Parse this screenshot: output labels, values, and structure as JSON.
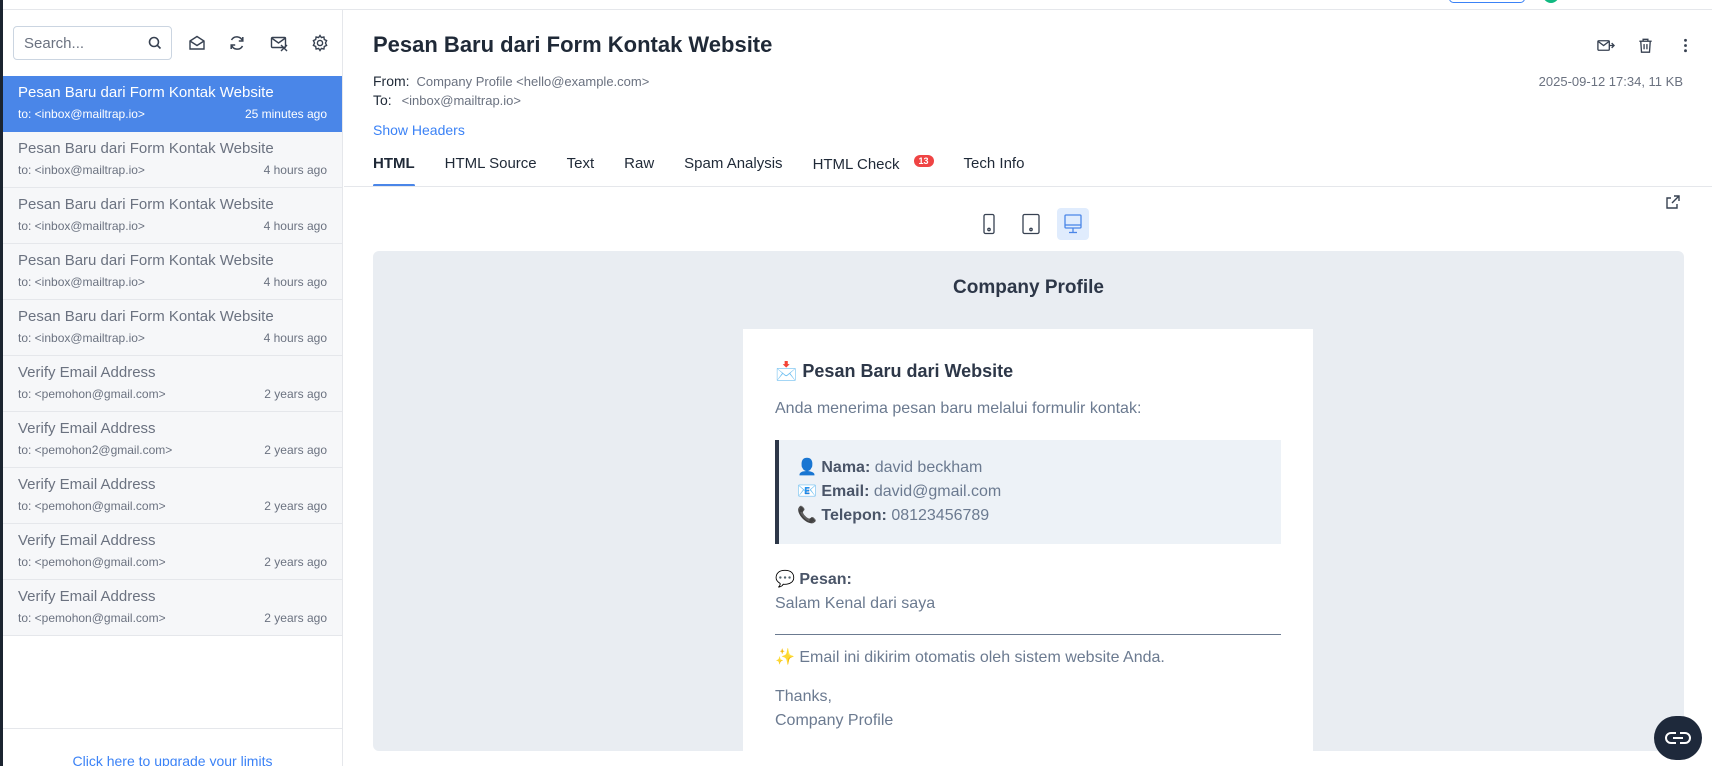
{
  "search": {
    "placeholder": "Search..."
  },
  "sidebar": {
    "toolbar": {
      "icons": [
        "search-icon",
        "mark-read-icon",
        "refresh-icon",
        "clear-inbox-icon",
        "settings-icon"
      ]
    },
    "messages": [
      {
        "subject": "Pesan Baru dari Form Kontak Website",
        "to": "to: <inbox@mailtrap.io>",
        "time": "25 minutes ago",
        "active": true
      },
      {
        "subject": "Pesan Baru dari Form Kontak Website",
        "to": "to: <inbox@mailtrap.io>",
        "time": "4 hours ago"
      },
      {
        "subject": "Pesan Baru dari Form Kontak Website",
        "to": "to: <inbox@mailtrap.io>",
        "time": "4 hours ago"
      },
      {
        "subject": "Pesan Baru dari Form Kontak Website",
        "to": "to: <inbox@mailtrap.io>",
        "time": "4 hours ago"
      },
      {
        "subject": "Pesan Baru dari Form Kontak Website",
        "to": "to: <inbox@mailtrap.io>",
        "time": "4 hours ago"
      },
      {
        "subject": "Verify Email Address",
        "to": "to: <pemohon@gmail.com>",
        "time": "2 years ago"
      },
      {
        "subject": "Verify Email Address",
        "to": "to: <pemohon2@gmail.com>",
        "time": "2 years ago"
      },
      {
        "subject": "Verify Email Address",
        "to": "to: <pemohon@gmail.com>",
        "time": "2 years ago"
      },
      {
        "subject": "Verify Email Address",
        "to": "to: <pemohon@gmail.com>",
        "time": "2 years ago"
      },
      {
        "subject": "Verify Email Address",
        "to": "to: <pemohon@gmail.com>",
        "time": "2 years ago"
      }
    ],
    "upgrade_label": "Click here to upgrade your limits"
  },
  "email": {
    "title": "Pesan Baru dari Form Kontak Website",
    "from_label": "From:",
    "from_value": "Company Profile <hello@example.com>",
    "to_label": "To:",
    "to_value": "<inbox@mailtrap.io>",
    "meta": "2025-09-12 17:34, 11 KB",
    "show_headers": "Show Headers",
    "actions": [
      "forward-icon",
      "trash-icon",
      "more-icon"
    ]
  },
  "tabs": [
    {
      "label": "HTML",
      "active": true
    },
    {
      "label": "HTML Source"
    },
    {
      "label": "Text"
    },
    {
      "label": "Raw"
    },
    {
      "label": "Spam Analysis"
    },
    {
      "label": "HTML Check",
      "badge": "13"
    },
    {
      "label": "Tech Info"
    }
  ],
  "preview": {
    "company": "Company Profile",
    "heading": "📩 Pesan Baru dari Website",
    "intro": "Anda menerima pesan baru melalui formulir kontak:",
    "fields": [
      {
        "icon": "👤",
        "label": "Nama:",
        "value": "david beckham"
      },
      {
        "icon": "📧",
        "label": "Email:",
        "value": "david@gmail.com"
      },
      {
        "icon": "📞",
        "label": "Telepon:",
        "value": "08123456789"
      }
    ],
    "pesan_icon": "💬",
    "pesan_label": "Pesan:",
    "pesan_value": "Salam Kenal dari saya",
    "auto_note": "✨ Email ini dikirim otomatis oleh sistem website Anda.",
    "thanks": "Thanks,",
    "signature": "Company Profile"
  },
  "colors": {
    "accent": "#4a86e8",
    "badge": "#ef4444",
    "preview_bg": "#e9edf2",
    "fab": "#1e293b"
  }
}
